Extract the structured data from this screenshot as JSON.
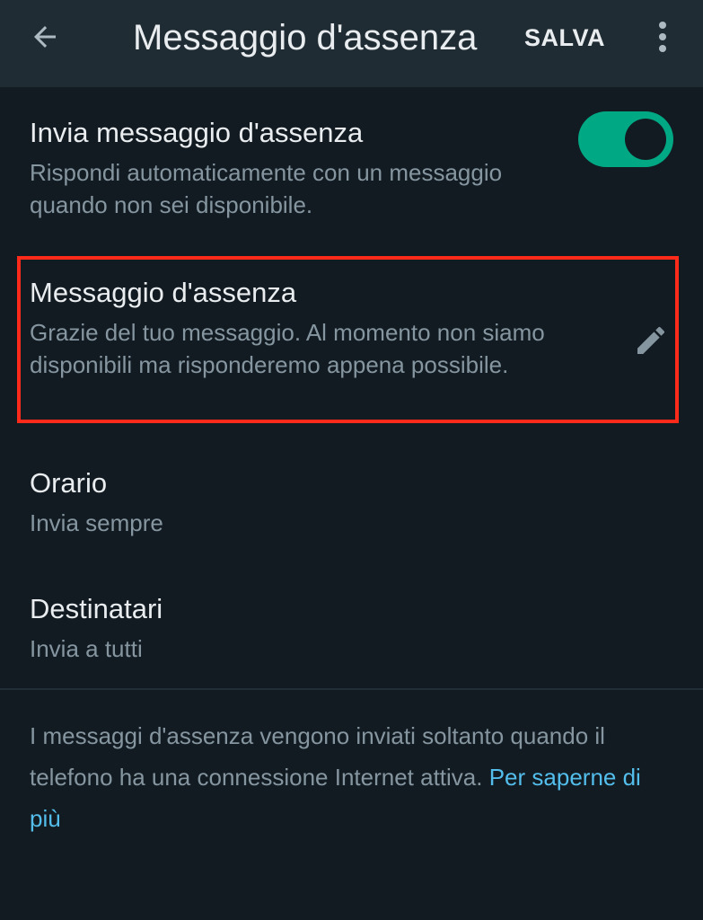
{
  "header": {
    "back_icon": "arrow-left-icon",
    "title": "Messaggio d'assenza",
    "save_label": "SALVA",
    "more_icon": "more-vertical-icon"
  },
  "send_away": {
    "label": "Invia messaggio d'assenza",
    "description": "Rispondi automaticamente con un messaggio quando non sei disponibile.",
    "enabled": true
  },
  "away_message": {
    "label": "Messaggio d'assenza",
    "text": "Grazie del tuo messaggio. Al momento non siamo disponibili ma risponderemo appena possibile.",
    "edit_icon": "pencil-icon"
  },
  "schedule": {
    "label": "Orario",
    "value": "Invia sempre"
  },
  "recipients": {
    "label": "Destinatari",
    "value": "Invia a tutti"
  },
  "footer": {
    "note": "I messaggi d'assenza vengono inviati soltanto quando il telefono ha una connessione Internet attiva.",
    "link_label": "Per saperne di più"
  },
  "colors": {
    "toolbar_bg": "#1f2c34",
    "page_bg": "#121b22",
    "accent_green": "#00a884",
    "link_blue": "#53bdeb",
    "highlight_red": "#ff2a1a",
    "secondary_text": "#8696a0"
  }
}
